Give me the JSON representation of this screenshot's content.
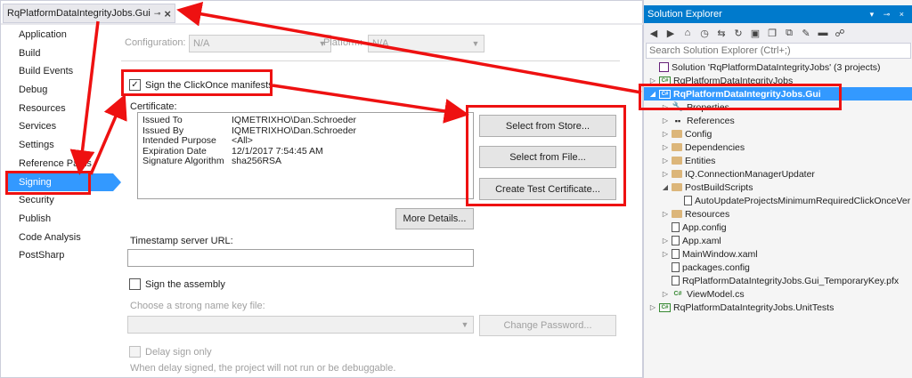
{
  "doc_tab": {
    "title": "RqPlatformDataIntegrityJobs.Gui",
    "pin_glyph": "⊸",
    "close_glyph": "×"
  },
  "nav": {
    "items": [
      {
        "label": "Application"
      },
      {
        "label": "Build"
      },
      {
        "label": "Build Events"
      },
      {
        "label": "Debug"
      },
      {
        "label": "Resources"
      },
      {
        "label": "Services"
      },
      {
        "label": "Settings"
      },
      {
        "label": "Reference Paths"
      },
      {
        "label": "Signing",
        "selected": true
      },
      {
        "label": "Security"
      },
      {
        "label": "Publish"
      },
      {
        "label": "Code Analysis"
      },
      {
        "label": "PostSharp"
      }
    ]
  },
  "config": {
    "configuration_label": "Configuration:",
    "configuration_value": "N/A",
    "platform_label": "Platform:",
    "platform_value": "N/A"
  },
  "signing": {
    "sign_manifests_label": "Sign the ClickOnce manifests",
    "sign_manifests_checked": true,
    "certificate_label": "Certificate:",
    "cert": [
      {
        "key": "Issued To",
        "value": "IQMETRIXHO\\Dan.Schroeder"
      },
      {
        "key": "Issued By",
        "value": "IQMETRIXHO\\Dan.Schroeder"
      },
      {
        "key": "Intended Purpose",
        "value": "<All>"
      },
      {
        "key": "Expiration Date",
        "value": "12/1/2017 7:54:45 AM"
      },
      {
        "key": "Signature Algorithm",
        "value": "sha256RSA"
      }
    ],
    "select_from_store": "Select from Store...",
    "select_from_file": "Select from File...",
    "create_test_cert": "Create Test Certificate...",
    "more_details": "More Details...",
    "timestamp_label": "Timestamp server URL:",
    "timestamp_value": "",
    "sign_assembly_label": "Sign the assembly",
    "strong_name_label": "Choose a strong name key file:",
    "change_password": "Change Password...",
    "delay_sign_label": "Delay sign only",
    "delay_sign_note": "When delay signed, the project will not run or be debuggable."
  },
  "solution_explorer": {
    "title": "Solution Explorer",
    "title_controls": "▾ ⊸ ×",
    "search_placeholder": "Search Solution Explorer (Ctrl+;)",
    "tree": [
      {
        "label": "Solution 'RqPlatformDataIntegrityJobs' (3 projects)",
        "icon": "sol",
        "level": 0,
        "exp": ""
      },
      {
        "label": "RqPlatformDataIntegrityJobs",
        "icon": "proj",
        "level": 0,
        "exp": "▷"
      },
      {
        "label": "RqPlatformDataIntegrityJobs.Gui",
        "icon": "proj",
        "level": 0,
        "exp": "◢",
        "selected": true
      },
      {
        "label": "Properties",
        "icon": "props",
        "level": 1,
        "exp": "▷"
      },
      {
        "label": "References",
        "icon": "ref",
        "level": 1,
        "exp": "▷"
      },
      {
        "label": "Config",
        "icon": "folder",
        "level": 1,
        "exp": "▷"
      },
      {
        "label": "Dependencies",
        "icon": "folder",
        "level": 1,
        "exp": "▷"
      },
      {
        "label": "Entities",
        "icon": "folder",
        "level": 1,
        "exp": "▷"
      },
      {
        "label": "IQ.ConnectionManagerUpdater",
        "icon": "folder",
        "level": 1,
        "exp": "▷"
      },
      {
        "label": "PostBuildScripts",
        "icon": "folder",
        "level": 1,
        "exp": "◢"
      },
      {
        "label": "AutoUpdateProjectsMinimumRequiredClickOnceVer",
        "icon": "file",
        "level": 2,
        "exp": ""
      },
      {
        "label": "Resources",
        "icon": "folder",
        "level": 1,
        "exp": "▷"
      },
      {
        "label": "App.config",
        "icon": "file",
        "level": 1,
        "exp": ""
      },
      {
        "label": "App.xaml",
        "icon": "file",
        "level": 1,
        "exp": "▷"
      },
      {
        "label": "MainWindow.xaml",
        "icon": "file",
        "level": 1,
        "exp": "▷"
      },
      {
        "label": "packages.config",
        "icon": "file",
        "level": 1,
        "exp": ""
      },
      {
        "label": "RqPlatformDataIntegrityJobs.Gui_TemporaryKey.pfx",
        "icon": "file",
        "level": 1,
        "exp": ""
      },
      {
        "label": "ViewModel.cs",
        "icon": "cs",
        "level": 1,
        "exp": "▷"
      },
      {
        "label": "RqPlatformDataIntegrityJobs.UnitTests",
        "icon": "proj",
        "level": 0,
        "exp": "▷"
      }
    ]
  },
  "colors": {
    "annotation_red": "#ee1111",
    "selection_blue": "#3399ff",
    "title_blue": "#007acc"
  }
}
